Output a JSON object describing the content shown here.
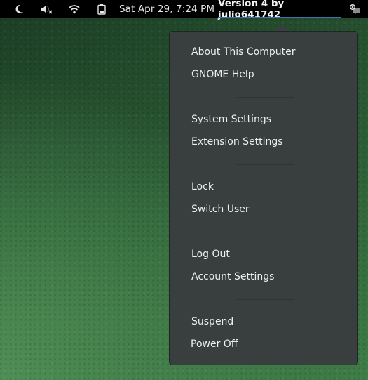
{
  "topbar": {
    "icons": [
      {
        "name": "night-light-icon",
        "glyph": "moon"
      },
      {
        "name": "volume-muted-icon",
        "glyph": "speaker-x"
      },
      {
        "name": "wifi-icon",
        "glyph": "wifi"
      },
      {
        "name": "battery-icon",
        "glyph": "battery"
      }
    ],
    "clock": "Sat Apr 29,  7:24 PM",
    "user_menu_label": "Version 4 by julio641742",
    "extra_icon": "chat-status-icon",
    "accent_color": "#3d6fb4"
  },
  "menu": {
    "groups": [
      {
        "items": [
          "About This Computer",
          "GNOME Help"
        ]
      },
      {
        "items": [
          "System Settings",
          "Extension Settings"
        ]
      },
      {
        "items": [
          "Lock",
          "Switch User"
        ]
      },
      {
        "items": [
          "Log Out",
          "Account Settings"
        ]
      },
      {
        "items": [
          "Suspend",
          "Power Off"
        ]
      }
    ],
    "background_color": "#393f3f",
    "text_color": "#eeeeec"
  }
}
